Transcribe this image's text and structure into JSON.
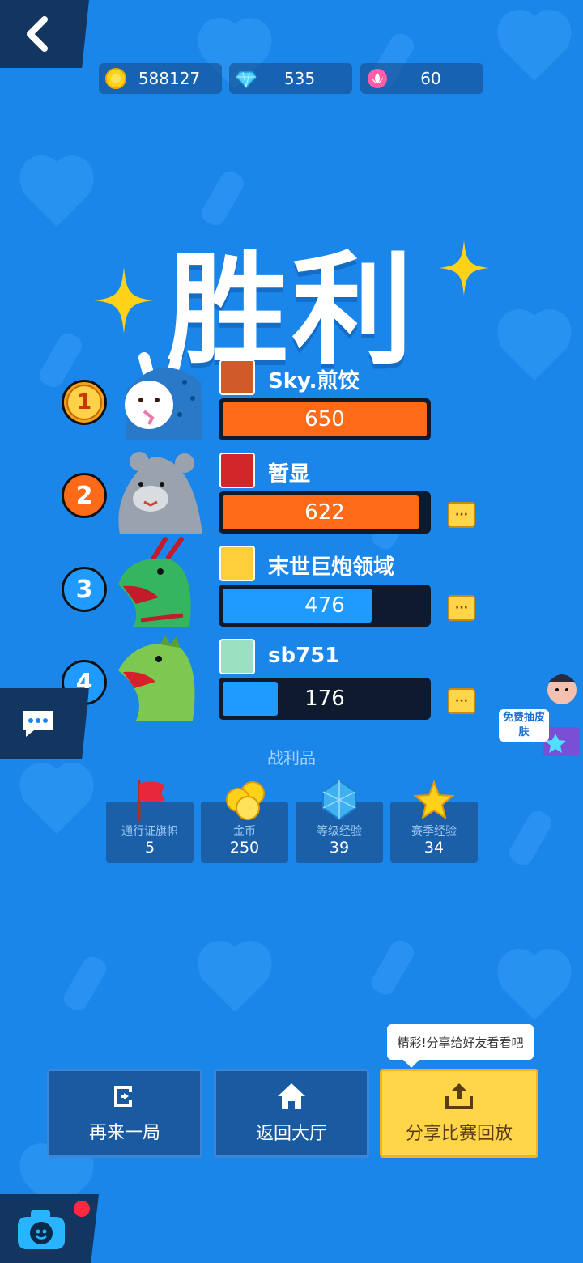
{
  "currencies": [
    {
      "name": "coin-icon",
      "value": "588127",
      "color": "#ffd21a"
    },
    {
      "name": "diamond-icon",
      "value": "535",
      "color": "#4fd0ff"
    },
    {
      "name": "lotus-icon",
      "value": "60",
      "color": "#ff5fa8"
    }
  ],
  "title": "胜利",
  "players": [
    {
      "rank": "1",
      "name": "Sky.煎饺",
      "score": "650",
      "fill": 1.0,
      "bar_color": "#ff6a18",
      "rank_bg": "#f4a21a"
    },
    {
      "rank": "2",
      "name": "暂显",
      "score": "622",
      "fill": 0.96,
      "bar_color": "#ff6a18",
      "rank_bg": "#ff6a18"
    },
    {
      "rank": "3",
      "name": "末世巨炮领域",
      "score": "476",
      "fill": 0.73,
      "bar_color": "#1f9bff",
      "rank_bg": "#1f9bff"
    },
    {
      "rank": "4",
      "name": "sb751",
      "score": "176",
      "fill": 0.27,
      "bar_color": "#1f9bff",
      "rank_bg": "#1f9bff"
    }
  ],
  "more_icon": "···",
  "free_skin_label": "免费抽皮肤",
  "loot": {
    "title": "战利品",
    "items": [
      {
        "label": "通行证旗帜",
        "amount": "5"
      },
      {
        "label": "金币",
        "amount": "250"
      },
      {
        "label": "等级经验",
        "amount": "39"
      },
      {
        "label": "赛季经验",
        "amount": "34"
      }
    ]
  },
  "buttons": {
    "again": "再来一局",
    "lobby": "返回大厅",
    "share": "分享比赛回放",
    "share_tip": "精彩!分享给好友看看吧"
  }
}
